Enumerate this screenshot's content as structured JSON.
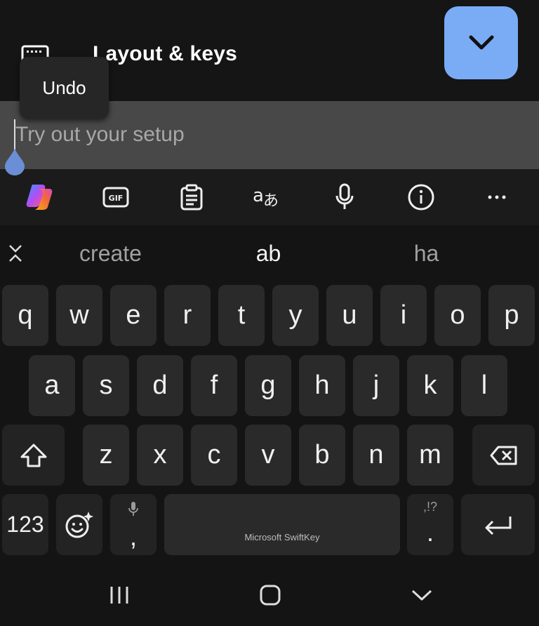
{
  "header": {
    "title": "Layout & keys",
    "settings_icon": "keyboard-icon",
    "collapse_icon": "chevron-down-icon",
    "accent_color": "#7aacf5"
  },
  "tooltip": {
    "label": "Undo"
  },
  "input": {
    "placeholder": "Try out your setup",
    "value": ""
  },
  "toolbar": {
    "items": [
      "copilot-icon",
      "gif-icon",
      "clipboard-icon",
      "translate-icon",
      "microphone-icon",
      "info-icon",
      "more-icon"
    ]
  },
  "suggestions": {
    "items": [
      "create",
      "ab",
      "ha"
    ],
    "collapse_icon": "collapse-suggestions-icon"
  },
  "keyboard": {
    "row1": [
      "q",
      "w",
      "e",
      "r",
      "t",
      "y",
      "u",
      "i",
      "o",
      "p"
    ],
    "row2": [
      "a",
      "s",
      "d",
      "f",
      "g",
      "h",
      "j",
      "k",
      "l"
    ],
    "row3": [
      "z",
      "x",
      "c",
      "v",
      "b",
      "n",
      "m"
    ],
    "numbers_label": "123",
    "comma_label": ",",
    "period_label": ".",
    "punct_hint": ",!?",
    "brand": "Microsoft SwiftKey"
  },
  "navbar": {
    "items": [
      "recent-apps-icon",
      "home-icon",
      "back-icon"
    ]
  }
}
